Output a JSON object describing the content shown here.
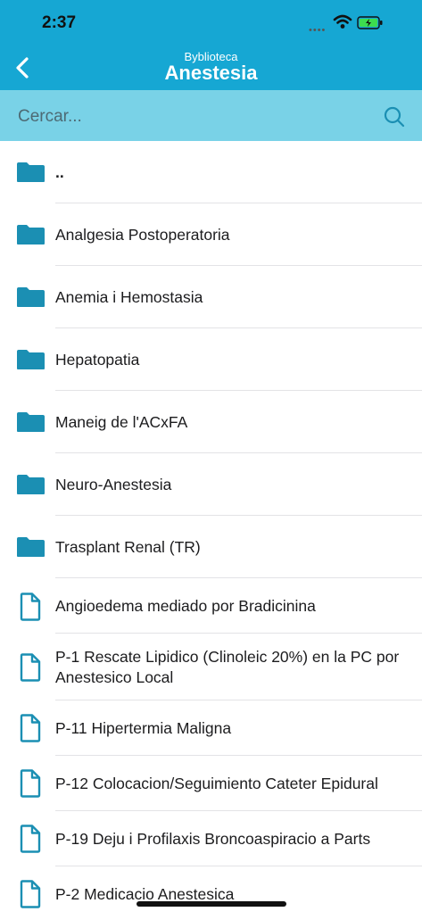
{
  "status": {
    "time": "2:37",
    "signal": "••••"
  },
  "nav": {
    "subtitle": "Byblioteca",
    "title": "Anestesia"
  },
  "search": {
    "placeholder": "Cercar..."
  },
  "colors": {
    "header": "#16a7d3",
    "search_bar": "#79d2e7",
    "icon": "#1b8fb3"
  },
  "items": [
    {
      "type": "folder",
      "label": ".."
    },
    {
      "type": "folder",
      "label": "Analgesia Postoperatoria"
    },
    {
      "type": "folder",
      "label": "Anemia i Hemostasia"
    },
    {
      "type": "folder",
      "label": "Hepatopatia"
    },
    {
      "type": "folder",
      "label": "Maneig de l'ACxFA"
    },
    {
      "type": "folder",
      "label": "Neuro-Anestesia"
    },
    {
      "type": "folder",
      "label": "Trasplant Renal (TR)"
    },
    {
      "type": "file",
      "label": "Angioedema mediado por Bradicinina"
    },
    {
      "type": "file",
      "label": "P-1 Rescate Lipidico (Clinoleic 20%) en la PC por Anestesico Local"
    },
    {
      "type": "file",
      "label": "P-11 Hipertermia Maligna"
    },
    {
      "type": "file",
      "label": "P-12 Colocacion/Seguimiento Cateter Epidural"
    },
    {
      "type": "file",
      "label": "P-19 Deju i Profilaxis Broncoaspiracio a Parts"
    },
    {
      "type": "file",
      "label": "P-2 Medicacio Anestesica"
    }
  ]
}
